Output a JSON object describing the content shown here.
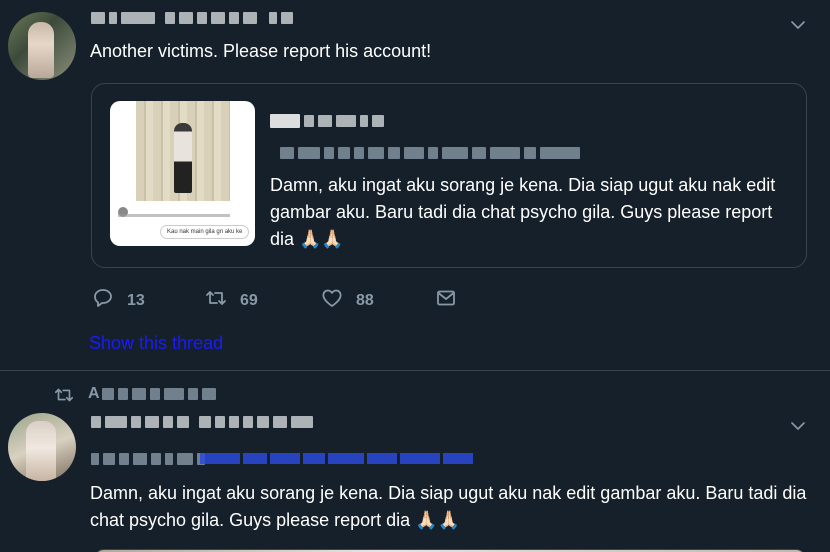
{
  "tweet1": {
    "text": "Another victims. Please report his account!",
    "quote": {
      "text": "Damn, aku ingat aku sorang je kena. Dia siap ugut aku nak edit gambar aku. Baru tadi dia chat psycho gila. Guys please report dia 🙏🏻🙏🏻",
      "media_caption": "Kau nak main gila gn aku ke"
    },
    "reply_count": "13",
    "retweet_count": "69",
    "like_count": "88",
    "show_thread": "Show this thread"
  },
  "tweet2": {
    "retweet_label": "A",
    "text": "Damn, aku ingat aku sorang je kena. Dia siap ugut aku nak edit gambar aku. Baru tadi dia chat psycho gila. Guys please report dia 🙏🏻🙏🏻"
  },
  "icons": {
    "chevron": "chevron-down-icon",
    "reply": "reply-icon",
    "retweet": "retweet-icon",
    "like": "heart-icon",
    "share": "mail-icon"
  },
  "colors": {
    "background": "#15202b",
    "secondary_text": "#8899a6",
    "border": "#38444d",
    "link": "#1a1aff"
  }
}
